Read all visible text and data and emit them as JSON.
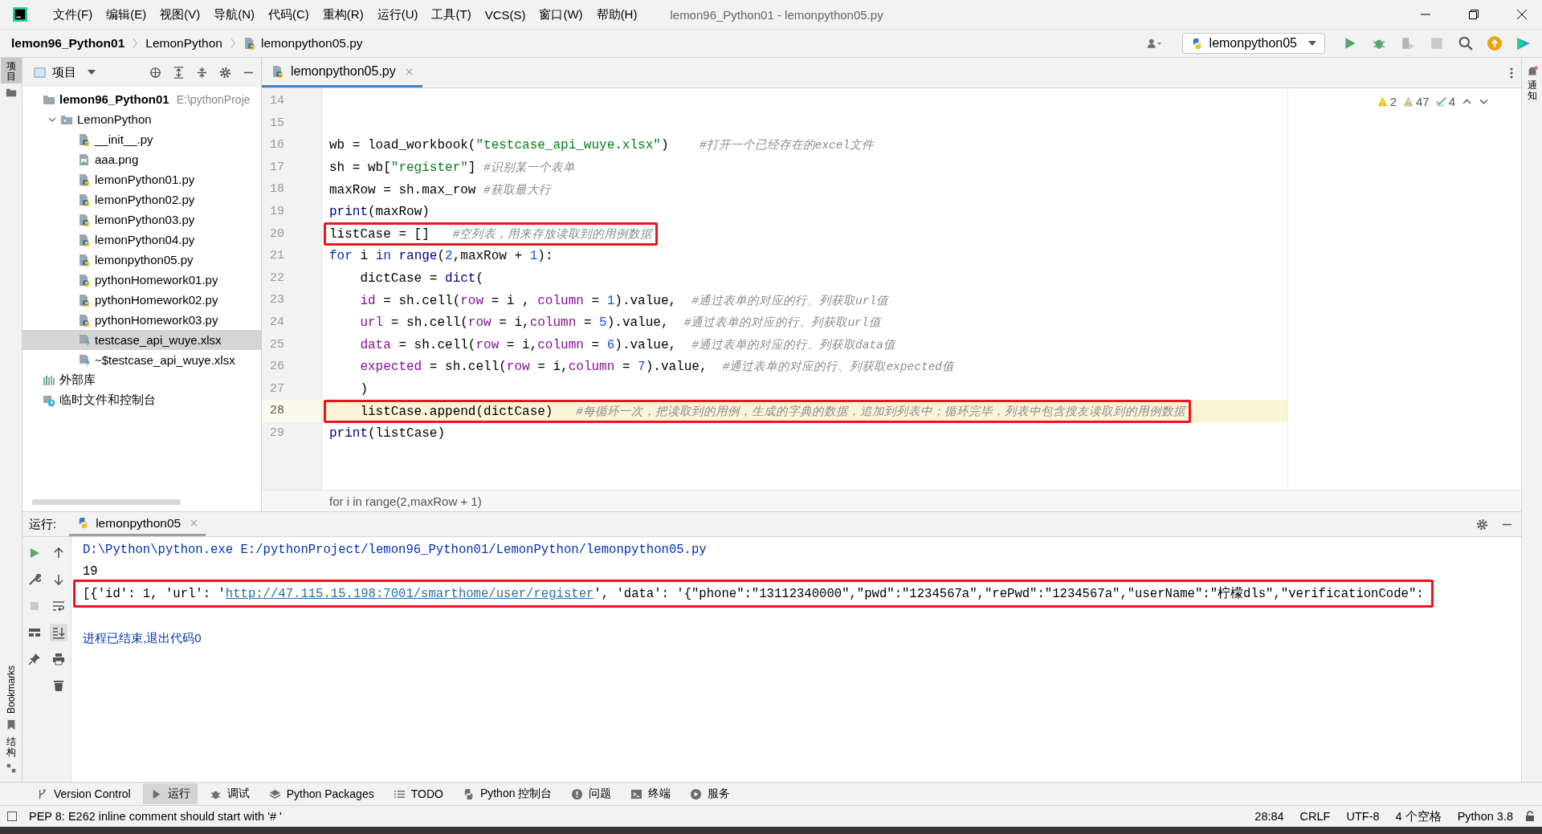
{
  "window": {
    "title": "lemon96_Python01 - lemonpython05.py"
  },
  "menu": [
    "文件(F)",
    "编辑(E)",
    "视图(V)",
    "导航(N)",
    "代码(C)",
    "重构(R)",
    "运行(U)",
    "工具(T)",
    "VCS(S)",
    "窗口(W)",
    "帮助(H)"
  ],
  "breadcrumb": [
    "lemon96_Python01",
    "LemonPython",
    "lemonpython05.py"
  ],
  "run_config": "lemonpython05",
  "left_strip": [
    {
      "label": "项目",
      "kind": "cjk",
      "selected": true
    },
    {
      "label": "Bookmarks",
      "kind": "latin",
      "selected": false
    },
    {
      "label": "结构",
      "kind": "cjk",
      "selected": false
    }
  ],
  "right_strip": [
    {
      "label": "通知",
      "kind": "cjk",
      "selected": false
    }
  ],
  "project_panel": {
    "title": "项目",
    "tree": [
      {
        "name": "lemon96_Python01",
        "path": "E:\\pythonProje",
        "kind": "root",
        "children": [
          {
            "name": "LemonPython",
            "kind": "folder",
            "expanded": true,
            "selected": false,
            "children": [
              {
                "name": "__init__.py",
                "kind": "py",
                "selected": false
              },
              {
                "name": "aaa.png",
                "kind": "image",
                "selected": false
              },
              {
                "name": "lemonPython01.py",
                "kind": "py",
                "selected": false
              },
              {
                "name": "lemonPython02.py",
                "kind": "py",
                "selected": false
              },
              {
                "name": "lemonPython03.py",
                "kind": "py",
                "selected": false
              },
              {
                "name": "lemonPython04.py",
                "kind": "py",
                "selected": false
              },
              {
                "name": "lemonpython05.py",
                "kind": "py",
                "selected": false
              },
              {
                "name": "pythonHomework01.py",
                "kind": "py",
                "selected": false
              },
              {
                "name": "pythonHomework02.py",
                "kind": "py",
                "selected": false
              },
              {
                "name": "pythonHomework03.py",
                "kind": "py",
                "selected": false
              },
              {
                "name": "testcase_api_wuye.xlsx",
                "kind": "unknown",
                "selected": true
              },
              {
                "name": "~$testcase_api_wuye.xlsx",
                "kind": "unknown",
                "selected": false
              }
            ]
          }
        ]
      },
      {
        "name": "外部库",
        "kind": "library"
      },
      {
        "name": "临时文件和控制台",
        "kind": "scratch"
      }
    ]
  },
  "editor": {
    "tab": "lemonpython05.py",
    "inspections": {
      "errors": "2",
      "warnings": "47",
      "typos": "4"
    },
    "lines": [
      {
        "number": "14",
        "boxed": false,
        "current": false
      },
      {
        "number": "15",
        "boxed": false,
        "current": false
      },
      {
        "number": "16",
        "boxed": false,
        "current": false,
        "tokens": [
          {
            "kind": "plain",
            "text": "wb = load_workbook("
          },
          {
            "kind": "str",
            "text": "\"testcase_api_wuye.xlsx\""
          },
          {
            "kind": "plain",
            "text": ")    "
          },
          {
            "kind": "comment",
            "text": "#打开一个已经存在的excel文件"
          }
        ]
      },
      {
        "number": "17",
        "boxed": false,
        "current": false,
        "tokens": [
          {
            "kind": "plain",
            "text": "sh = wb["
          },
          {
            "kind": "str",
            "text": "\"register\""
          },
          {
            "kind": "plain",
            "text": "] "
          },
          {
            "kind": "comment",
            "text": "#识别某一个表单"
          }
        ]
      },
      {
        "number": "18",
        "boxed": false,
        "current": false,
        "tokens": [
          {
            "kind": "plain",
            "text": "maxRow = sh.max_row "
          },
          {
            "kind": "comment",
            "text": "#获取最大行"
          }
        ]
      },
      {
        "number": "19",
        "boxed": false,
        "current": false,
        "tokens": [
          {
            "kind": "builtin",
            "text": "print"
          },
          {
            "kind": "plain",
            "text": "(maxRow)"
          }
        ]
      },
      {
        "number": "20",
        "boxed": true,
        "current": false,
        "tokens": [
          {
            "kind": "plain",
            "text": "listCase = []   "
          },
          {
            "kind": "comment",
            "text": "#空列表，用来存放读取到的用例数据"
          }
        ]
      },
      {
        "number": "21",
        "boxed": false,
        "current": false,
        "tokens": [
          {
            "kind": "kw",
            "text": "for"
          },
          {
            "kind": "plain",
            "text": " i "
          },
          {
            "kind": "kw",
            "text": "in "
          },
          {
            "kind": "builtin",
            "text": "range"
          },
          {
            "kind": "plain",
            "text": "("
          },
          {
            "kind": "num",
            "text": "2"
          },
          {
            "kind": "plain",
            "text": ",maxRow + "
          },
          {
            "kind": "num",
            "text": "1"
          },
          {
            "kind": "plain",
            "text": "):"
          }
        ]
      },
      {
        "number": "22",
        "boxed": false,
        "current": false,
        "tokens": [
          {
            "kind": "plain",
            "text": "    dictCase = "
          },
          {
            "kind": "builtin",
            "text": "dict"
          },
          {
            "kind": "plain",
            "text": "("
          }
        ]
      },
      {
        "number": "23",
        "boxed": false,
        "current": false,
        "tokens": [
          {
            "kind": "param",
            "text": "    id"
          },
          {
            "kind": "plain",
            "text": " = sh.cell("
          },
          {
            "kind": "param",
            "text": "row"
          },
          {
            "kind": "plain",
            "text": " = i , "
          },
          {
            "kind": "param",
            "text": "column"
          },
          {
            "kind": "plain",
            "text": " = "
          },
          {
            "kind": "num",
            "text": "1"
          },
          {
            "kind": "plain",
            "text": ").value,  "
          },
          {
            "kind": "comment",
            "text": "#通过表单的对应的行、列获取url值"
          }
        ]
      },
      {
        "number": "24",
        "boxed": false,
        "current": false,
        "tokens": [
          {
            "kind": "param",
            "text": "    url"
          },
          {
            "kind": "plain",
            "text": " = sh.cell("
          },
          {
            "kind": "param",
            "text": "row"
          },
          {
            "kind": "plain",
            "text": " = i,"
          },
          {
            "kind": "param",
            "text": "column"
          },
          {
            "kind": "plain",
            "text": " = "
          },
          {
            "kind": "num",
            "text": "5"
          },
          {
            "kind": "plain",
            "text": ").value,  "
          },
          {
            "kind": "comment",
            "text": "#通过表单的对应的行、列获取url值"
          }
        ]
      },
      {
        "number": "25",
        "boxed": false,
        "current": false,
        "tokens": [
          {
            "kind": "param",
            "text": "    data"
          },
          {
            "kind": "plain",
            "text": " = sh.cell("
          },
          {
            "kind": "param",
            "text": "row"
          },
          {
            "kind": "plain",
            "text": " = i,"
          },
          {
            "kind": "param",
            "text": "column"
          },
          {
            "kind": "plain",
            "text": " = "
          },
          {
            "kind": "num",
            "text": "6"
          },
          {
            "kind": "plain",
            "text": ").value,  "
          },
          {
            "kind": "comment",
            "text": "#通过表单的对应的行、列获取data值"
          }
        ]
      },
      {
        "number": "26",
        "boxed": false,
        "current": false,
        "tokens": [
          {
            "kind": "param",
            "text": "    expected"
          },
          {
            "kind": "plain",
            "text": " = sh.cell("
          },
          {
            "kind": "param",
            "text": "row"
          },
          {
            "kind": "plain",
            "text": " = i,"
          },
          {
            "kind": "param",
            "text": "column"
          },
          {
            "kind": "plain",
            "text": " = "
          },
          {
            "kind": "num",
            "text": "7"
          },
          {
            "kind": "plain",
            "text": ").value,  "
          },
          {
            "kind": "comment",
            "text": "#通过表单的对应的行、列获取expected值"
          }
        ]
      },
      {
        "number": "27",
        "boxed": false,
        "current": false,
        "tokens": [
          {
            "kind": "plain",
            "text": "    )"
          }
        ]
      },
      {
        "number": "28",
        "boxed": true,
        "current": true,
        "tokens": [
          {
            "kind": "plain",
            "text": "    listCase.append(dictCase)   "
          },
          {
            "kind": "comment",
            "text": "#每循环一次，把读取到的用例，生成的字典的数据，追加到列表中；循环完毕，列表中包含搜友读取到的用例数据"
          }
        ]
      },
      {
        "number": "29",
        "boxed": false,
        "current": false,
        "tokens": [
          {
            "kind": "builtin",
            "text": "print"
          },
          {
            "kind": "plain",
            "text": "(listCase)"
          }
        ]
      }
    ],
    "context": "for i in range(2,maxRow + 1)"
  },
  "run_panel": {
    "label": "运行:",
    "tab": "lemonpython05",
    "output": [
      {
        "kind": "command",
        "boxed": false,
        "segments": [
          {
            "kind": "text",
            "text": "D:\\Python\\python.exe E:/pythonProject/lemon96_Python01/LemonPython/lemonpython05.py"
          }
        ]
      },
      {
        "kind": "stdout",
        "boxed": false,
        "segments": [
          {
            "kind": "text",
            "text": "19"
          }
        ]
      },
      {
        "kind": "stdout",
        "boxed": true,
        "segments": [
          {
            "kind": "text",
            "text": "[{'id': 1, 'url': '"
          },
          {
            "kind": "link",
            "text": "http://47.115.15.198:7001/smarthome/user/register"
          },
          {
            "kind": "text",
            "text": "', 'data': '{\"phone\":\"13112340000\",\"pwd\":\"1234567a\",\"rePwd\":\"1234567a\",\"userName\":\"柠檬dls\",\"verificationCode\":"
          }
        ]
      },
      {
        "kind": "blank",
        "boxed": false
      },
      {
        "kind": "system",
        "boxed": false,
        "segments": [
          {
            "kind": "text",
            "text": "进程已结束,退出代码0"
          }
        ]
      }
    ]
  },
  "tool_tabs": [
    {
      "label": "Version Control",
      "selected": false
    },
    {
      "label": "运行",
      "selected": true
    },
    {
      "label": "调试",
      "selected": false
    },
    {
      "label": "Python Packages",
      "selected": false
    },
    {
      "label": "TODO",
      "selected": false
    },
    {
      "label": "Python 控制台",
      "selected": false
    },
    {
      "label": "问题",
      "selected": false
    },
    {
      "label": "终端",
      "selected": false
    },
    {
      "label": "服务",
      "selected": false
    }
  ],
  "status_bar": {
    "message": "PEP 8: E262 inline comment should start with '# '",
    "items": [
      "28:84",
      "CRLF",
      "UTF-8",
      "4 个空格",
      "Python 3.8"
    ]
  }
}
